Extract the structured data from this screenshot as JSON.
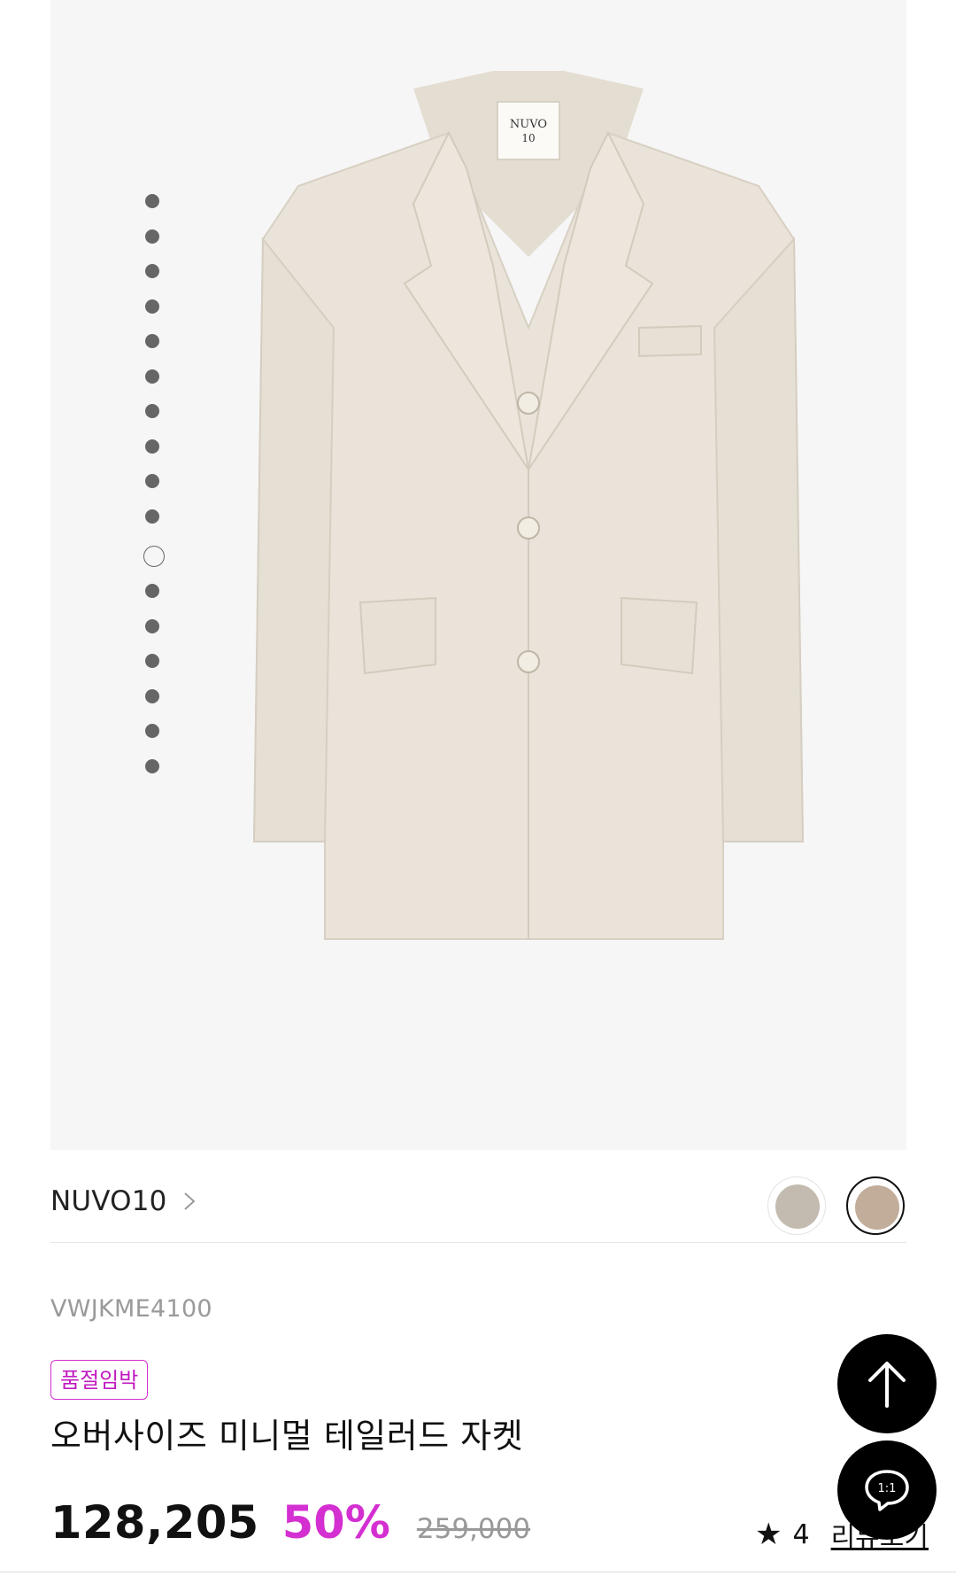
{
  "product": {
    "brand": "NUVO10",
    "sku": "VWJKME4100",
    "badge": "품절임박",
    "title": "오버사이즈 미니멀 테일러드 자켓",
    "price": "128,205",
    "discount": "50%",
    "original_price": "259,000",
    "rating_count": "4",
    "review_label": "리뷰보기",
    "label_text": "NUVO 10"
  },
  "gallery": {
    "total_images": 17,
    "active_index": 10
  },
  "colors": {
    "swatches": [
      "#c3bbaf",
      "#c2ad9b"
    ],
    "selected_index": 1,
    "accent": "#d42fd1",
    "jacket": "#e9e3d9"
  },
  "icons": {
    "scroll_top": "arrow-up-icon",
    "chat": "chat-bubble-icon",
    "chat_label": "1:1"
  }
}
